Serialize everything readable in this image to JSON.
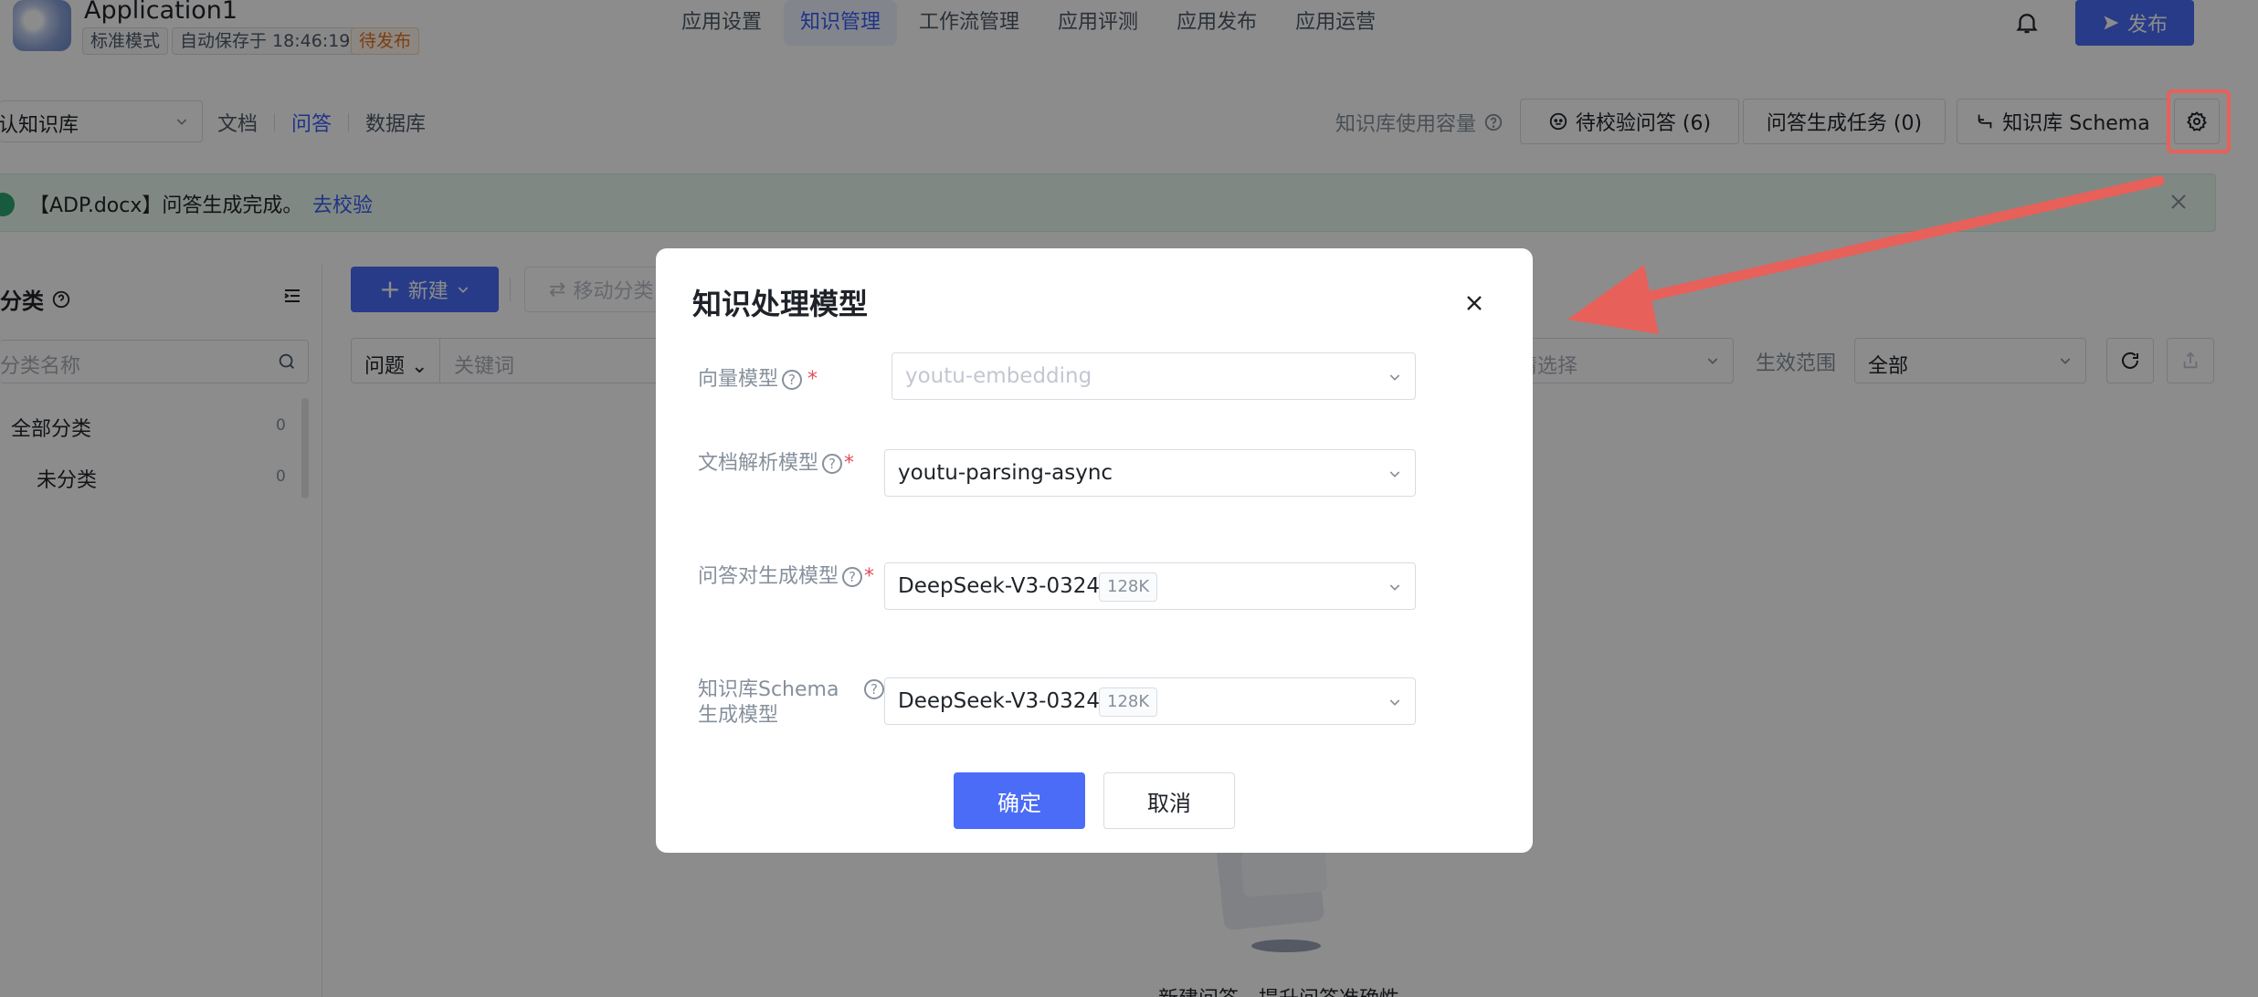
{
  "header": {
    "app_title": "Application1",
    "mode_tag": "标准模式",
    "autosave": "自动保存于 18:46:19",
    "status": "待发布",
    "nav": [
      "应用设置",
      "知识管理",
      "工作流管理",
      "应用评测",
      "应用发布",
      "应用运营"
    ],
    "active_nav": "知识管理",
    "publish_label": "发布"
  },
  "toolbar": {
    "kb_select": "默认知识库",
    "subtabs": [
      "文档",
      "问答",
      "数据库"
    ],
    "active_subtab": "问答",
    "capacity_label": "知识库使用容量",
    "pending_qa": "待校验问答 (6)",
    "gen_tasks": "问答生成任务 (0)",
    "schema": "知识库 Schema"
  },
  "banner": {
    "message": "【ADP.docx】问答生成完成。",
    "link": "去校验"
  },
  "sidebar": {
    "title": "分类",
    "search_placeholder": "分类名称",
    "items": [
      {
        "label": "全部分类",
        "count": "0"
      },
      {
        "label": "未分类",
        "count": "0"
      }
    ]
  },
  "main": {
    "new_label": "新建",
    "move_label": "移动分类",
    "filter_type": "问题",
    "keyword_placeholder": "关键词",
    "select_placeholder": "请选择",
    "scope_label": "生效范围",
    "scope_value": "全部",
    "empty_text": "新建问答，提升问答准确性"
  },
  "modal": {
    "title": "知识处理模型",
    "fields": [
      {
        "label": "向量模型",
        "value": "youtu-embedding",
        "ctx": ""
      },
      {
        "label": "文档解析模型",
        "value": "youtu-parsing-async",
        "ctx": ""
      },
      {
        "label": "问答对生成模型",
        "value": "DeepSeek-V3-0324",
        "ctx": "128K"
      },
      {
        "label_line1": "知识库Schema",
        "label_line2": "生成模型",
        "value": "DeepSeek-V3-0324",
        "ctx": "128K"
      }
    ],
    "ok_label": "确定",
    "cancel_label": "取消"
  },
  "colors": {
    "primary": "#4a6cf7",
    "annotation": "#e8605a",
    "success": "#2ba471",
    "pending": "#e37318"
  }
}
